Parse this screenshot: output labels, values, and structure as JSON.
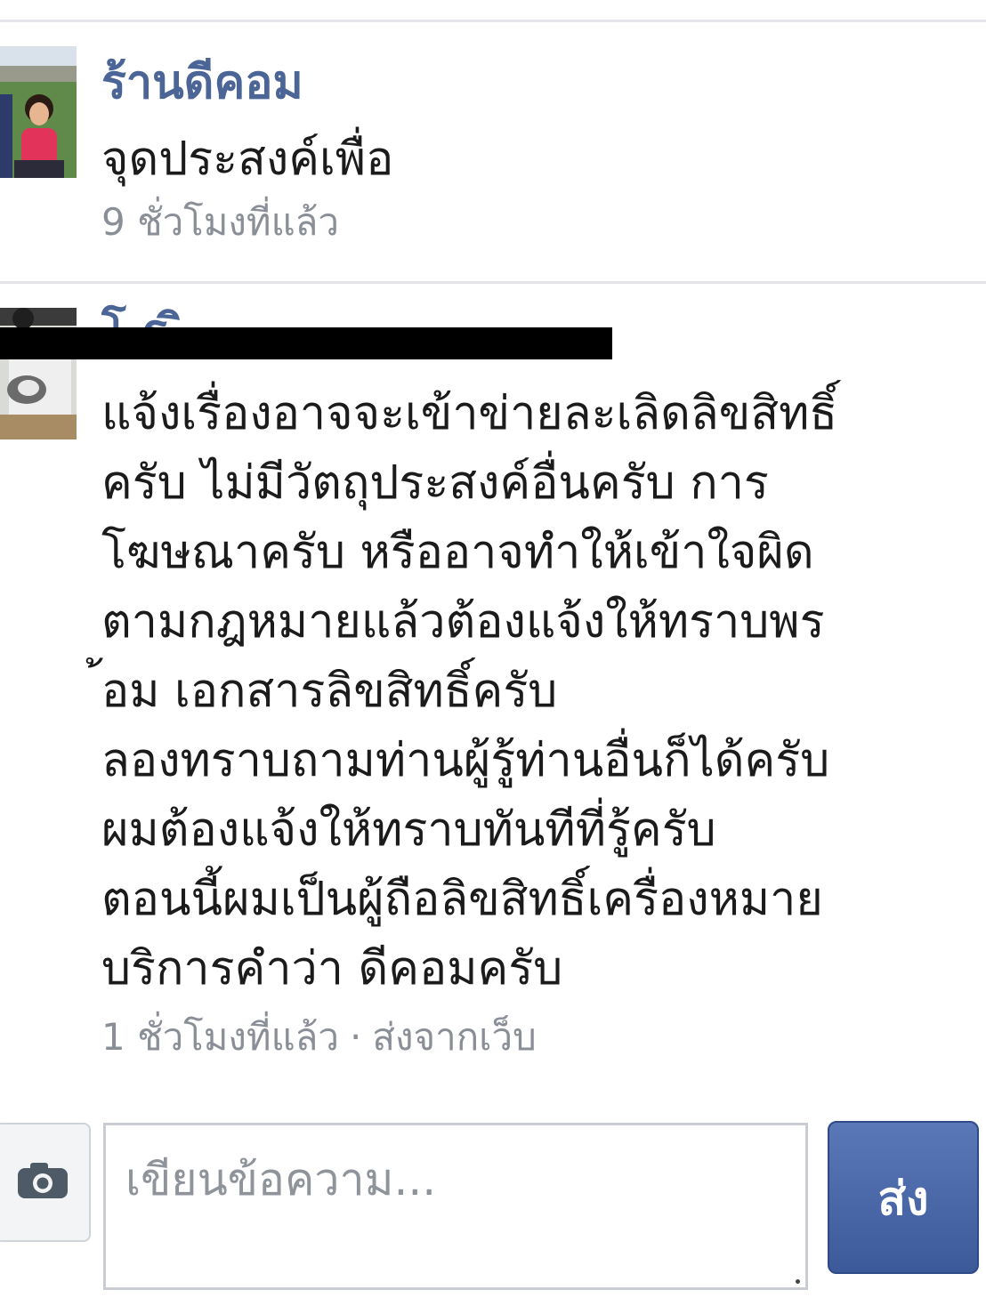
{
  "messages": [
    {
      "sender": "ร้านดีคอม",
      "text": "จุดประสงค์เพื่อ",
      "time": "9 ชั่วโมงที่แล้ว"
    },
    {
      "sender": "โ  ร  ิ",
      "text": "แจ้งเรื่องอาจจะเข้าข่ายละเลิดลิขสิทธิ์\nครับ ไม่มีวัตถุประสงค์อื่นครับ การ\nโฆษณาครับ หรืออาจทำให้เข้าใจผิด\nตามกฎหมายแล้วต้องแจ้งให้ทราบพร\n้อม เอกสารลิขสิทธิ์ครับ\nลองทราบถามท่านผู้รู้ท่านอื่นก็ได้ครับ\nผมต้องแจ้งให้ทราบทันทีที่รู้ครับ\nตอนนี้ผมเป็นผู้ถือลิขสิทธิ์เครื่องหมาย\nบริการคำว่า ดีคอมครับ",
      "time": "1 ชั่วโมงที่แล้ว",
      "separator": "·",
      "source": "ส่งจากเว็บ"
    }
  ],
  "composer": {
    "placeholder": "เขียนข้อความ...",
    "send_label": "ส่ง",
    "camera_icon": "camera-icon"
  },
  "colors": {
    "sender_name": "#4b6596",
    "send_button": "#3c5a9a",
    "meta_text": "#8a8e97"
  }
}
